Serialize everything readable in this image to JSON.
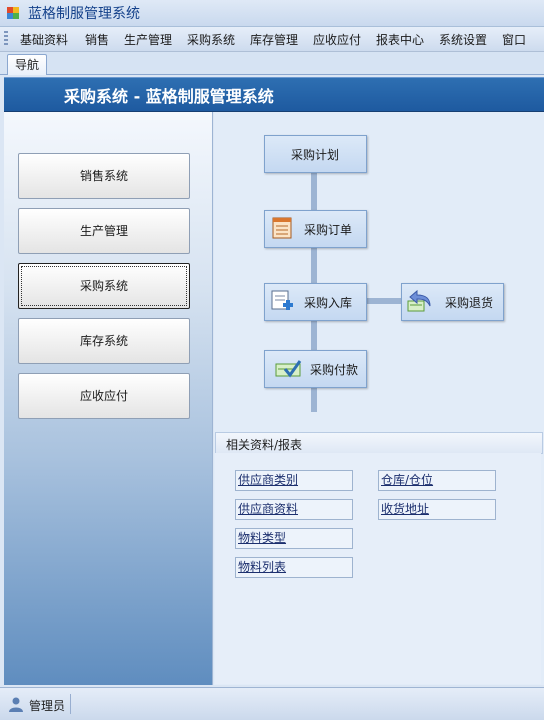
{
  "window": {
    "title": "蓝格制服管理系统",
    "icon": "app-icon"
  },
  "menu": [
    "基础资料",
    "销售",
    "生产管理",
    "采购系统",
    "库存管理",
    "应收应付",
    "报表中心",
    "系统设置",
    "窗口"
  ],
  "tab": {
    "label": "导航"
  },
  "header": {
    "title": "采购系统 - 蓝格制服管理系统"
  },
  "sidebar": {
    "items": [
      {
        "label": "销售系统"
      },
      {
        "label": "生产管理"
      },
      {
        "label": "采购系统",
        "active": true
      },
      {
        "label": "库存系统"
      },
      {
        "label": "应收应付"
      }
    ]
  },
  "flow": {
    "plan": {
      "label": "采购计划"
    },
    "order": {
      "label": "采购订单",
      "icon": "document-icon"
    },
    "receive": {
      "label": "采购入库",
      "icon": "add-doc-icon"
    },
    "return": {
      "label": "采购退货",
      "icon": "return-arrow-icon"
    },
    "payment": {
      "label": "采购付款",
      "icon": "check-money-icon"
    }
  },
  "related": {
    "title": "相关资料/报表",
    "links": [
      "供应商类别",
      "仓库/仓位",
      "供应商资料",
      "收货地址",
      "物料类型",
      "物料列表"
    ]
  },
  "status": {
    "user": "管理员",
    "icon": "user-icon"
  },
  "colors": {
    "header_blue": "#1e5aa0",
    "panel_bg": "#e2ecf8",
    "link": "#1c2f6e"
  }
}
